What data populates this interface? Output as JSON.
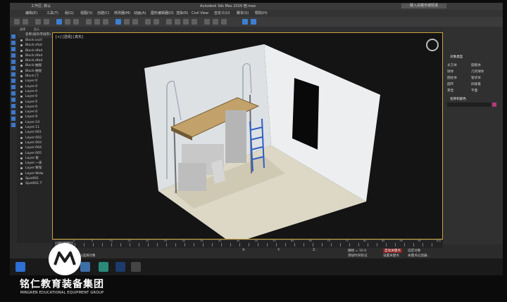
{
  "app": {
    "title": "Autodesk 3ds Max 2016   宿.max",
    "search_placeholder": "键入关键字或短语",
    "quick_access_label": "工作区: 默认"
  },
  "menu": [
    "编辑(E)",
    "工具(T)",
    "组(G)",
    "视图(V)",
    "创建(C)",
    "修改器(M)",
    "动画(A)",
    "图形编辑器(D)",
    "渲染(R)",
    "Civil View",
    "自定义(U)",
    "脚本(S)",
    "帮助(H)"
  ],
  "ribbon": {
    "tabs": [
      "选择",
      "显示"
    ]
  },
  "scene_explorer": {
    "header": "名称(按升序排序)",
    "items": [
      "Block:sscll",
      "Block:sfad",
      "Block:dfad",
      "Block:dfad",
      "Block:dfad",
      "Block:抽屉",
      "Block:抽屉",
      "Block:门",
      "Layer:0",
      "Layer:0",
      "Layer:0",
      "Layer:0",
      "Layer:0",
      "Layer:0",
      "Layer:0",
      "Layer:9",
      "Layer:10",
      "Layer:11",
      "Layer:001",
      "Layer:002",
      "Layer:003",
      "Layer:004",
      "Layer:005",
      "Layer:窗",
      "Layer:一床",
      "Layer:铁架",
      "Layer:Wdw",
      "Spot001",
      "Spot001.T"
    ]
  },
  "viewport": {
    "label": "[+] [透视] [真实]"
  },
  "command_panel": {
    "rollout_title": "对象类型",
    "buttons": [
      "长方体",
      "圆锥体",
      "球体",
      "几何球体",
      "圆柱体",
      "管状体",
      "圆环",
      "四棱锥",
      "茶壶",
      "平面"
    ],
    "name_color_title": "名称和颜色"
  },
  "timeline": {
    "frame_label": "0 / 100",
    "ticks": [
      "0",
      "5",
      "10",
      "15",
      "20",
      "25",
      "30",
      "35",
      "40",
      "45",
      "50",
      "55",
      "60",
      "65",
      "70",
      "75",
      "80",
      "85",
      "90",
      "95",
      "100"
    ]
  },
  "status": {
    "selection": "未选定任何对象",
    "prompt": "单击或单击并拖动以选择对象",
    "x_label": "X:",
    "y_label": "Y:",
    "z_label": "Z:",
    "grid": "栅格 = 10.0",
    "auto_key": "自动关键点",
    "set_key": "设置关键点",
    "selected": "选定对象",
    "add_time_tag": "添加时间标记",
    "key_filters": "关键点过滤器..."
  },
  "watermark": {
    "chinese": "铭仁教育装备集团",
    "english": "MINGREN EDUCATIONAL EQUIPMENT GROUP"
  },
  "colors": {
    "accent": "#3b78c9",
    "viewport_border": "#c9a53a",
    "wall": "#e9ecef",
    "floor": "#ddd8c6",
    "wood": "#c2a26a",
    "ladder": "#2f5fc4"
  }
}
